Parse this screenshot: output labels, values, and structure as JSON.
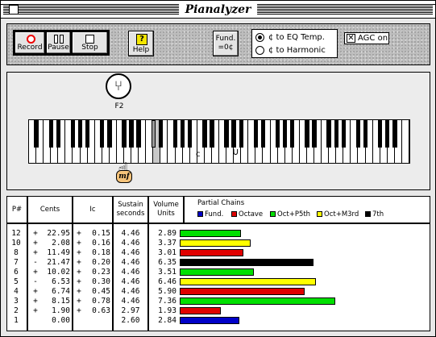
{
  "window": {
    "title": "Pianalyzer"
  },
  "toolbar": {
    "record_label": "Record",
    "pause_label": "Pause",
    "stop_label": "Stop",
    "help_label": "Help",
    "help_glyph": "?",
    "fund_label_1": "Fund.",
    "fund_label_2": "=0¢",
    "mode_options": [
      "¢ to EQ Temp.",
      "¢ to Harmonic"
    ],
    "mode_selected": 0,
    "agc_label": "AGC on",
    "agc_checked": true
  },
  "keyboard": {
    "note_name": "F2",
    "fork_icon": "tuning-fork-icon",
    "dynamic_marking": "mf",
    "middle_c_label": "c",
    "white_key_count": 52,
    "active_white_key_index": 17
  },
  "table": {
    "headers": {
      "partial": "P#",
      "cents": "Cents",
      "ic": "Ic",
      "sustain_1": "Sustain",
      "sustain_2": "seconds",
      "volume_1": "Volume",
      "volume_2": "Units",
      "chains": "Partial Chains"
    },
    "legend": [
      {
        "label": "Fund.",
        "color": "#0000c8"
      },
      {
        "label": "Octave",
        "color": "#e00000"
      },
      {
        "label": "Oct+P5th",
        "color": "#00e000"
      },
      {
        "label": "Oct+M3rd",
        "color": "#ffff00"
      },
      {
        "label": "7th",
        "color": "#000000"
      }
    ],
    "rows": [
      {
        "p": "12",
        "cs": "+",
        "cents": "22.95",
        "is": "+",
        "ic": "0.15",
        "sustain": "4.46",
        "volume": "2.89",
        "volume_value": 2.89,
        "color": "#00e000"
      },
      {
        "p": "10",
        "cs": "+",
        "cents": "2.08",
        "is": "+",
        "ic": "0.16",
        "sustain": "4.46",
        "volume": "3.37",
        "volume_value": 3.37,
        "color": "#ffff00"
      },
      {
        "p": "8",
        "cs": "+",
        "cents": "11.49",
        "is": "+",
        "ic": "0.18",
        "sustain": "4.46",
        "volume": "3.01",
        "volume_value": 3.01,
        "color": "#e00000"
      },
      {
        "p": "7",
        "cs": "-",
        "cents": "21.47",
        "is": "+",
        "ic": "0.20",
        "sustain": "4.46",
        "volume": "6.35",
        "volume_value": 6.35,
        "color": "#000000"
      },
      {
        "p": "6",
        "cs": "+",
        "cents": "10.02",
        "is": "+",
        "ic": "0.23",
        "sustain": "4.46",
        "volume": "3.51",
        "volume_value": 3.51,
        "color": "#00e000"
      },
      {
        "p": "5",
        "cs": "-",
        "cents": "6.53",
        "is": "+",
        "ic": "0.30",
        "sustain": "4.46",
        "volume": "6.46",
        "volume_value": 6.46,
        "color": "#ffff00"
      },
      {
        "p": "4",
        "cs": "+",
        "cents": "6.74",
        "is": "+",
        "ic": "0.45",
        "sustain": "4.46",
        "volume": "5.90",
        "volume_value": 5.9,
        "color": "#e00000"
      },
      {
        "p": "3",
        "cs": "+",
        "cents": "8.15",
        "is": "+",
        "ic": "0.78",
        "sustain": "4.46",
        "volume": "7.36",
        "volume_value": 7.36,
        "color": "#00e000"
      },
      {
        "p": "2",
        "cs": "+",
        "cents": "1.90",
        "is": "+",
        "ic": "0.63",
        "sustain": "2.97",
        "volume": "1.93",
        "volume_value": 1.93,
        "color": "#e00000"
      },
      {
        "p": "1",
        "cs": "",
        "cents": "0.00",
        "is": "",
        "ic": "",
        "sustain": "2.60",
        "volume": "2.84",
        "volume_value": 2.84,
        "color": "#0000c8"
      }
    ]
  }
}
